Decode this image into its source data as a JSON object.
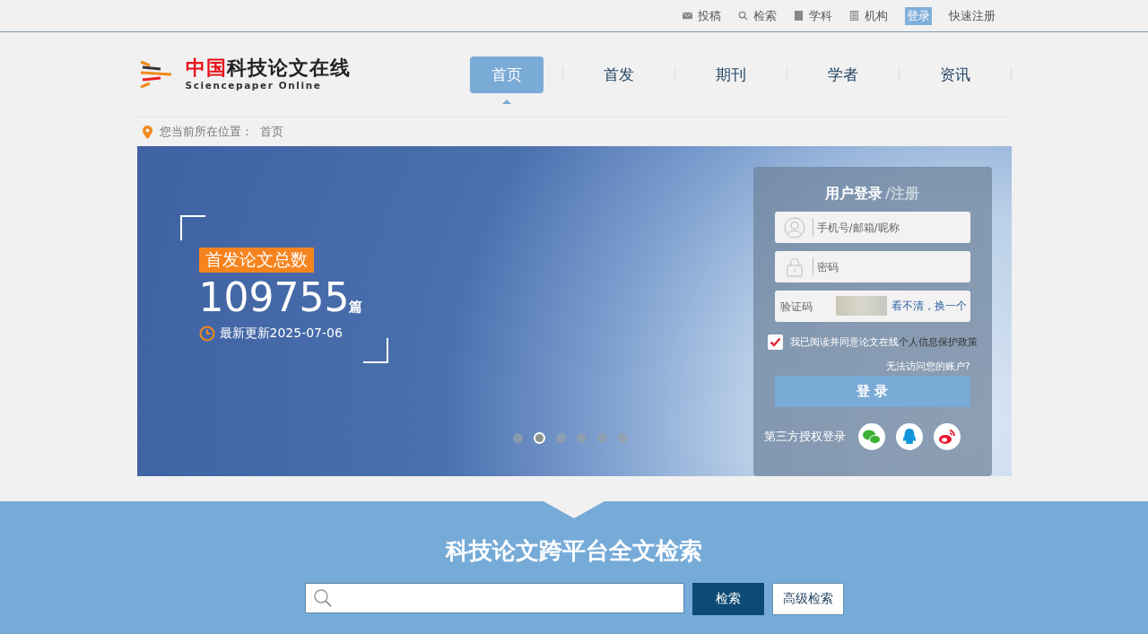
{
  "top_links": [
    {
      "kind": "mail",
      "label": "投稿",
      "highlighted": false
    },
    {
      "kind": "search",
      "label": "检索",
      "highlighted": false
    },
    {
      "kind": "book",
      "label": "学科",
      "highlighted": false
    },
    {
      "kind": "doc",
      "label": "机构",
      "highlighted": false
    },
    {
      "kind": "none",
      "label": "登录",
      "highlighted": true
    },
    {
      "kind": "none",
      "label": "快速注册",
      "highlighted": false
    }
  ],
  "logo": {
    "mark": "中国",
    "name": "科技论文在线",
    "subtitle": "Sciencepaper Online"
  },
  "nav": [
    {
      "label": "首页",
      "selected": true
    },
    {
      "label": "首发",
      "selected": false
    },
    {
      "label": "期刊",
      "selected": false
    },
    {
      "label": "学者",
      "selected": false
    },
    {
      "label": "资讯",
      "selected": false
    }
  ],
  "breadcrumb": {
    "label": "您当前所在位置：",
    "current": "首页"
  },
  "banner": {
    "badge": "首发论文总数",
    "count": "109755",
    "unit": "篇",
    "updated": "最新更新2025-07-06",
    "dots": [
      {
        "selected": false
      },
      {
        "selected": true
      },
      {
        "selected": false
      },
      {
        "selected": false
      },
      {
        "selected": false
      },
      {
        "selected": false
      }
    ]
  },
  "login": {
    "title": "用户登录",
    "register": "/注册",
    "username_placeholder": "手机号/邮箱/昵称",
    "password_placeholder": "密码",
    "captcha_placeholder": "验证码",
    "refresh": "看不清，换一个",
    "agree": {
      "checked": true,
      "text": "我已阅读并同意论文在线",
      "link": "个人信息保护政策"
    },
    "forgot": "无法访问您的账户?",
    "submit": "登 录",
    "third_party": "第三方授权登录",
    "providers": [
      {
        "kind": "wechat"
      },
      {
        "kind": "qq"
      },
      {
        "kind": "weibo"
      }
    ]
  },
  "search": {
    "title": "科技论文跨平台全文检索",
    "button": "检索",
    "advanced": "高级检索"
  }
}
